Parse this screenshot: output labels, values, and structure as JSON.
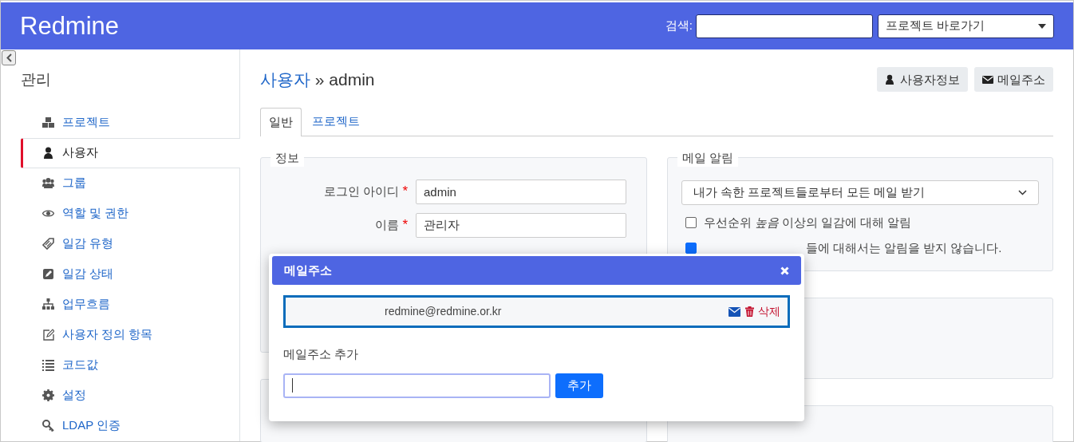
{
  "header": {
    "logo": "Redmine",
    "search_label": "검색:",
    "project_jump": "프로젝트 바로가기"
  },
  "sidebar": {
    "title": "관리",
    "items": [
      {
        "label": "프로젝트",
        "selected": false
      },
      {
        "label": "사용자",
        "selected": true
      },
      {
        "label": "그룹",
        "selected": false
      },
      {
        "label": "역할 및 권한",
        "selected": false
      },
      {
        "label": "일감 유형",
        "selected": false
      },
      {
        "label": "일감 상태",
        "selected": false
      },
      {
        "label": "업무흐름",
        "selected": false
      },
      {
        "label": "사용자 정의 항목",
        "selected": false
      },
      {
        "label": "코드값",
        "selected": false
      },
      {
        "label": "설정",
        "selected": false
      },
      {
        "label": "LDAP 인증",
        "selected": false
      }
    ]
  },
  "page": {
    "breadcrumb_parent": "사용자",
    "breadcrumb_current": "» admin",
    "actions": [
      {
        "label": "사용자정보"
      },
      {
        "label": "메일주소"
      }
    ],
    "tabs": [
      {
        "label": "일반",
        "selected": true
      },
      {
        "label": "프로젝트",
        "selected": false
      }
    ],
    "info": {
      "legend": "정보",
      "fields": [
        {
          "label": "로그인 아이디",
          "required_mark": "*",
          "value": "admin"
        },
        {
          "label": "이름",
          "required_mark": "*",
          "value": "관리자"
        }
      ]
    },
    "mail_notification": {
      "legend": "메일 알림",
      "select": "내가 속한 프로젝트들로부터 모든 메일 받기",
      "options": [
        {
          "label": "우선순위 *높음* 이상의 일감에 대해 알림",
          "checked": false
        },
        {
          "label": "들에 대해서는 알림을 받지 않습니다.",
          "checked": true
        }
      ]
    }
  },
  "dialog": {
    "title": "메일주소",
    "addresses": [
      {
        "email": "redmine@redmine.or.kr",
        "delete": "삭제",
        "selected": true
      }
    ],
    "add_label": "메일주소 추가",
    "add_button": "추가"
  }
}
